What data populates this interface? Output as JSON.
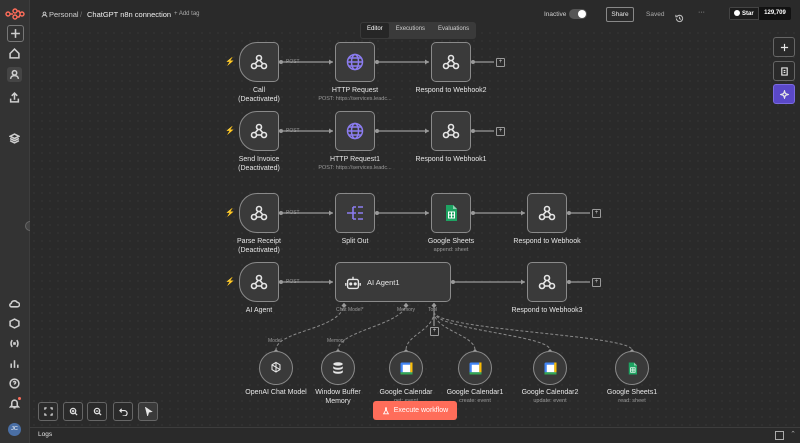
{
  "topbar": {
    "project": "Personal",
    "separator": "/",
    "workflow_name": "ChatGPT n8n connection",
    "add_tag": "+ Add tag",
    "active_label": "Inactive",
    "share": "Share",
    "saved": "Saved",
    "more": "···",
    "github_star": "Star",
    "github_count": "129,709"
  },
  "tabs": [
    "Editor",
    "Executions",
    "Evaluations"
  ],
  "rows": [
    {
      "trigger": "Call\n(Deactivated)",
      "trigger_l1": "Call",
      "trigger_l2": "(Deactivated)",
      "edge": "POST",
      "n2": "HTTP Request",
      "n2_sub": "POST: https://services.leadc...",
      "n3": "Respond to Webhook2"
    },
    {
      "trigger_l1": "Send Invoice",
      "trigger_l2": "(Deactivated)",
      "edge": "POST",
      "n2": "HTTP Request1",
      "n2_sub": "POST: https://services.leadc...",
      "n3": "Respond to Webhook1"
    },
    {
      "trigger_l1": "Parse Receipt",
      "trigger_l2": "(Deactivated)",
      "edge": "POST",
      "n2": "Split Out",
      "n3": "Google Sheets",
      "n3_sub": "append: sheet",
      "n4": "Respond to Webhook"
    },
    {
      "trigger_l1": "AI Agent",
      "edge": "POST",
      "agent": "AI Agent1",
      "n3": "Respond to Webhook3",
      "ports": [
        "Chat Model*",
        "Memory",
        "Tool"
      ]
    }
  ],
  "subnodes": [
    {
      "label": "OpenAI Chat Model",
      "edge": "Model"
    },
    {
      "label": "Window Buffer\nMemory",
      "l1": "Window Buffer",
      "l2": "Memory",
      "edge": "Memory"
    },
    {
      "label": "Google Calendar",
      "sub": "get: event"
    },
    {
      "label": "Google Calendar1",
      "sub": "create: event"
    },
    {
      "label": "Google Calendar2",
      "sub": "update: event"
    },
    {
      "label": "Google Sheets1",
      "sub": "read: sheet"
    }
  ],
  "execute_button": "Execute workflow",
  "logs_label": "Logs",
  "user_initials": "JC",
  "colors": {
    "accent": "#ff6d5a",
    "canvas": "#2a2a2a",
    "node_fill": "#3a3a3a",
    "node_border": "#8a8a8a",
    "ai_purple": "#6b5bd6"
  }
}
